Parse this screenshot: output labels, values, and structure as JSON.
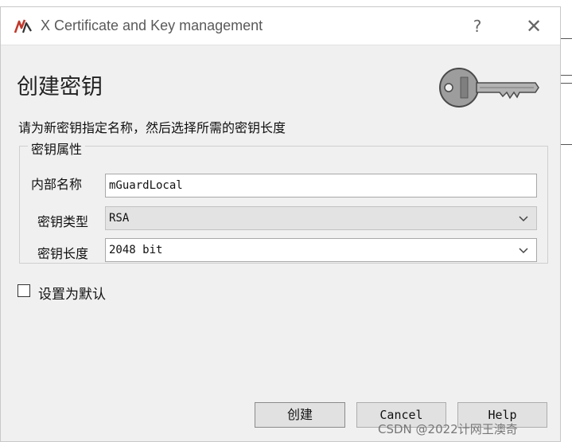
{
  "window": {
    "title": "X Certificate and Key management",
    "help_glyph": "?",
    "close_glyph": "✕"
  },
  "heading": "创建密钥",
  "description": "请为新密钥指定名称，然后选择所需的密钥长度",
  "key_properties": {
    "legend": "密钥属性",
    "name": {
      "label": "内部名称",
      "value": "mGuardLocal"
    },
    "key_type": {
      "label": "密钥类型",
      "value": "RSA"
    },
    "key_size": {
      "label": "密钥长度",
      "value": "2048 bit"
    }
  },
  "set_default": {
    "label": "设置为默认",
    "checked": false
  },
  "buttons": {
    "create": "创建",
    "cancel": "Cancel",
    "help": "Help"
  },
  "watermark": "CSDN @2022计网王澳奇",
  "icons": [
    "xca-app-icon",
    "help-icon",
    "close-icon",
    "key-icon",
    "chevron-down-icon",
    "checkbox-icon"
  ],
  "colors": {
    "dialog_bg": "#f0f0f0",
    "titlebar_bg": "#ffffff",
    "key_gray": "#9a9a9a"
  }
}
